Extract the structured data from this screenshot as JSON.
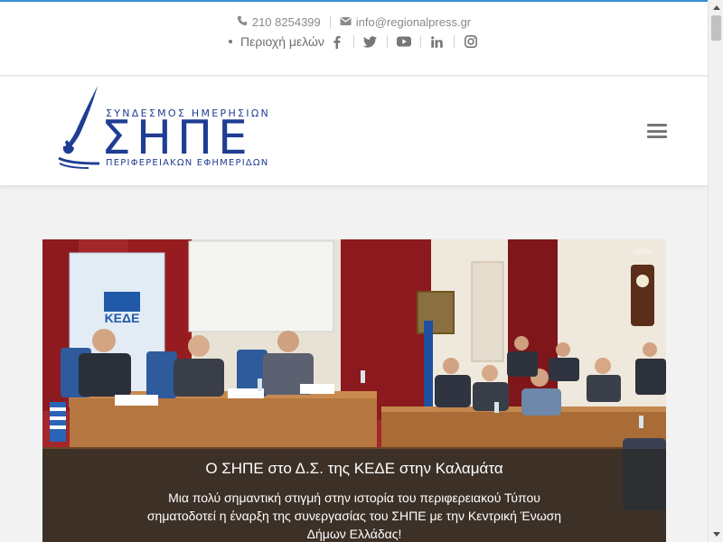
{
  "topbar": {
    "phone": "210 8254399",
    "email": "info@regionalpress.gr",
    "members_area": "Περιοχή μελών",
    "social": [
      "facebook-icon",
      "twitter-icon",
      "youtube-icon",
      "linkedin-icon",
      "instagram-icon"
    ]
  },
  "logo": {
    "top_text": "ΣΥΝΔΕΣΜΟΣ ΗΜΕΡΗΣΙΩΝ",
    "main_text": "ΣΗΠΕ",
    "bottom_text": "ΠΕΡΙΦΕΡΕΙΑΚΩΝ ΕΦΗΜΕΡΙΔΩΝ"
  },
  "hero": {
    "banner_text": "ΚΕΔΕ",
    "title": "Ο ΣΗΠΕ στο Δ.Σ. της ΚΕΔΕ στην Καλαμάτα",
    "text": "Μια πολύ σημαντική στιγμή στην ιστορία του περιφερειακού Τύπου σηματοδοτεί η έναρξη της συνεργασίας του ΣΗΠΕ με την Κεντρική Ένωση Δήμων Ελλάδας!"
  },
  "colors": {
    "accent": "#3a8fd6",
    "brand": "#1f3d93",
    "curtain": "#8a1c1f"
  }
}
